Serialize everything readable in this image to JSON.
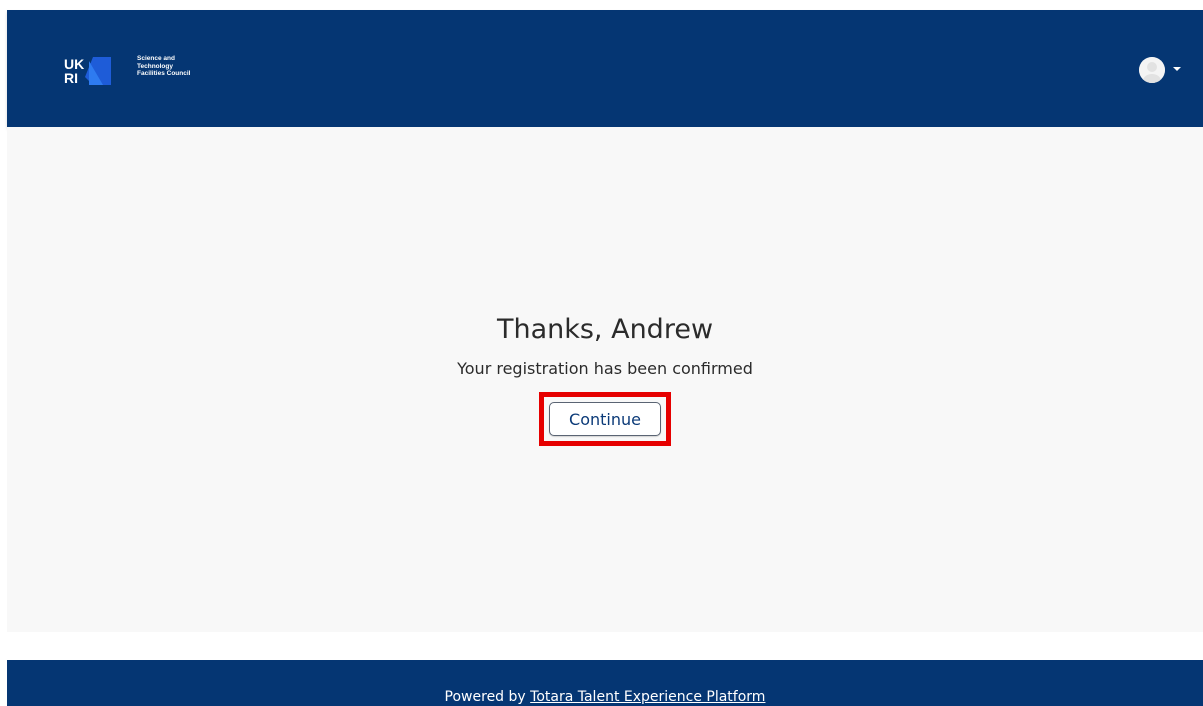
{
  "header": {
    "logo": {
      "mark_letters": [
        "UK",
        "RI"
      ],
      "council_lines": [
        "Science and",
        "Technology",
        "Facilities Council"
      ]
    },
    "user_menu": {
      "avatar_icon": "user-avatar-icon",
      "caret_icon": "caret-down-icon"
    }
  },
  "main": {
    "title": "Thanks, Andrew",
    "message": "Your registration has been confirmed",
    "continue_label": "Continue"
  },
  "footer": {
    "powered_prefix": "Powered by",
    "platform_link": "Totara Talent Experience Platform"
  },
  "colors": {
    "brand_navy": "#053673",
    "highlight_red": "#e60000",
    "button_text": "#0b3a78"
  }
}
